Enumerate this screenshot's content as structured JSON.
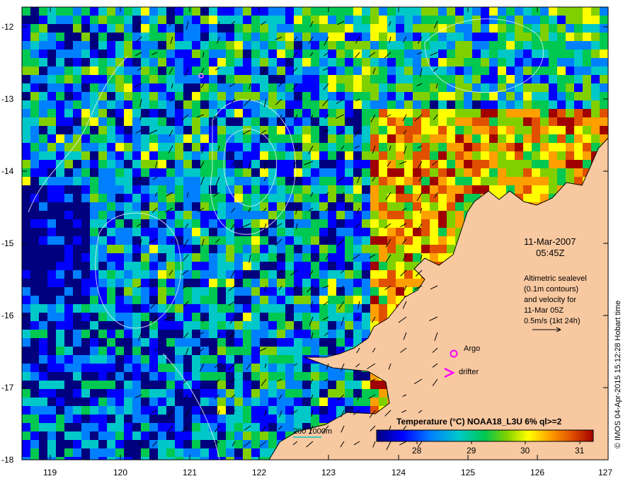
{
  "map": {
    "date": "11-Mar-2007",
    "time": "05:45Z",
    "info_lines": [
      "Altimetric sealevel",
      "(0.1m contours)",
      "and velocity for",
      "11-Mar 05Z",
      "0.5m/s (1kt 24h)"
    ],
    "argo_label": "Argo",
    "drifter_label": "drifter",
    "colorbar_title": "Temperature (°C) NOAA18_L3U 6% ql>=2",
    "colorbar_ticks": [
      "28",
      "29",
      "30",
      "31"
    ],
    "bathymetry_label": "200  1000m",
    "credit": "© IMOS 04-Apr-2015 15:12:28 Hobart time",
    "lat_ticks": [
      "-12",
      "-13",
      "-14",
      "-15",
      "-16",
      "-17",
      "-18"
    ],
    "lon_ticks": [
      "119",
      "120",
      "121",
      "122",
      "123",
      "124",
      "125",
      "126",
      "127"
    ],
    "lat_range": [
      -18,
      -11.7
    ],
    "lon_range": [
      118.6,
      127
    ],
    "colors": {
      "land": "#f8c8a0",
      "sst_scale": [
        "#00007f",
        "#0000ff",
        "#0080ff",
        "#00c8c8",
        "#00c850",
        "#80d000",
        "#ffff00",
        "#ffa000",
        "#e05000",
        "#a00000"
      ],
      "argo": "#ff00ff",
      "drifter": "#ff00ff"
    }
  }
}
